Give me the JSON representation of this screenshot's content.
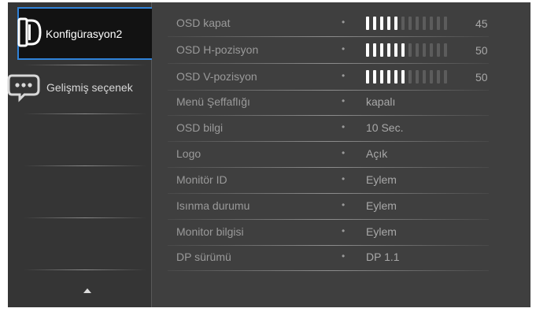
{
  "sidebar": {
    "items": [
      {
        "label": "Konfigürasyon2",
        "icon": "configuration-icon",
        "active": true
      },
      {
        "label": "Gelişmiş seçenek",
        "icon": "advanced-options-icon",
        "active": false
      }
    ],
    "scroll_up": "scroll-up-arrow-icon"
  },
  "settings": [
    {
      "name": "OSD kapat",
      "type": "slider",
      "value": "45",
      "level": 0.45
    },
    {
      "name": "OSD H-pozisyon",
      "type": "slider",
      "value": "50",
      "level": 0.5
    },
    {
      "name": "OSD V-pozisyon",
      "type": "slider",
      "value": "50",
      "level": 0.5
    },
    {
      "name": "Menü Şeffaflığı",
      "type": "text",
      "value": "kapalı"
    },
    {
      "name": "OSD bilgi",
      "type": "text",
      "value": "10 Sec."
    },
    {
      "name": "Logo",
      "type": "text",
      "value": "Açık"
    },
    {
      "name": "Monitör ID",
      "type": "text",
      "value": "Eylem"
    },
    {
      "name": "Isınma durumu",
      "type": "text",
      "value": "Eylem"
    },
    {
      "name": "Monitor bilgisi",
      "type": "text",
      "value": "Eylem"
    },
    {
      "name": "DP sürümü",
      "type": "text",
      "value": "DP 1.1"
    }
  ],
  "separator": "•",
  "colors": {
    "accent": "#2f82d8",
    "panel": "#3f3f3f",
    "sidebar": "#353535"
  }
}
